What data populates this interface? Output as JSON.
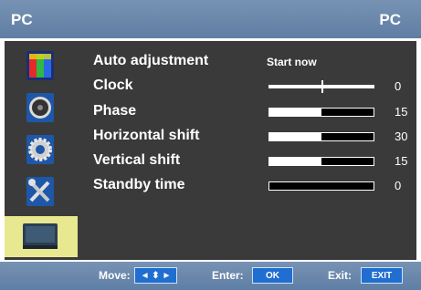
{
  "header": {
    "title_left": "PC",
    "title_right": "PC"
  },
  "sidebar": {
    "items": [
      {
        "icon": "picture-icon"
      },
      {
        "icon": "sound-icon"
      },
      {
        "icon": "setup-gear-icon"
      },
      {
        "icon": "tools-icon"
      },
      {
        "icon": "pc-icon",
        "selected": true
      }
    ]
  },
  "menu": {
    "auto_adjustment": {
      "label": "Auto adjustment",
      "action": "Start now"
    },
    "clock": {
      "label": "Clock",
      "value": "0",
      "level": 0.5
    },
    "phase": {
      "label": "Phase",
      "value": "15",
      "level": 0.5
    },
    "horizontal_shift": {
      "label": "Horizontal shift",
      "value": "30",
      "level": 0.5
    },
    "vertical_shift": {
      "label": "Vertical shift",
      "value": "15",
      "level": 0.5
    },
    "standby_time": {
      "label": "Standby time",
      "value": "0",
      "level": 0.0
    }
  },
  "footer": {
    "move_label": "Move:",
    "move_button": "◄ ⬍ ►",
    "enter_label": "Enter:",
    "enter_button": "OK",
    "exit_label": "Exit:",
    "exit_button": "EXIT"
  }
}
